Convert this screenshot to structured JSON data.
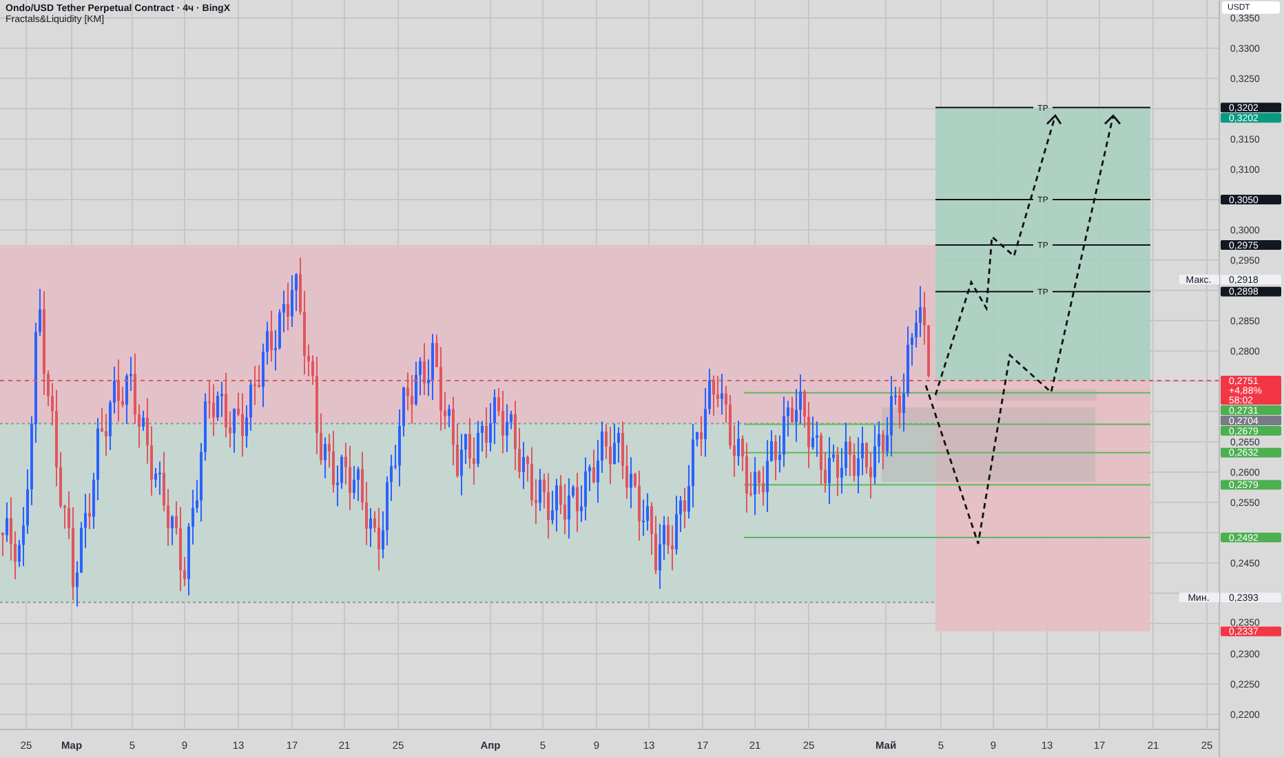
{
  "header": {
    "title": "Ondo/USD Tether Perpetual Contract · 4ч · BingX",
    "indicator": "Fractals&Liquidity [KM]"
  },
  "currency": "USDT",
  "price_axis": {
    "ticks": [
      "0,3350",
      "0,3300",
      "0,3250",
      "0,3150",
      "0,3100",
      "0,3000",
      "0,2950",
      "0,2850",
      "0,2800",
      "0,2650",
      "0,2600",
      "0,2550",
      "0,2450",
      "0,2350",
      "0,2300",
      "0,2250",
      "0,2200"
    ]
  },
  "price_labels": [
    {
      "value": "0,3202",
      "color": "#131722"
    },
    {
      "value": "0,3202",
      "color": "#089981"
    },
    {
      "value": "0,3050",
      "color": "#131722"
    },
    {
      "value": "0,2975",
      "color": "#131722"
    },
    {
      "caption": "Макс.",
      "value": "0,2918",
      "color": "#eef0f4"
    },
    {
      "value": "0,2898",
      "color": "#131722"
    },
    {
      "value": "0,2751",
      "color": "#f23645",
      "change": "+4,88%",
      "countdown": "58:02"
    },
    {
      "value": "0,2731",
      "color": "#4caf50"
    },
    {
      "value": "0,2704",
      "color": "#787b86"
    },
    {
      "value": "0,2679",
      "color": "#4caf50"
    },
    {
      "value": "0,2632",
      "color": "#4caf50"
    },
    {
      "value": "0,2579",
      "color": "#4caf50"
    },
    {
      "value": "0,2492",
      "color": "#4caf50"
    },
    {
      "caption": "Мин.",
      "value": "0,2393",
      "color": "#eef0f4"
    },
    {
      "value": "0,2337",
      "color": "#f23645"
    }
  ],
  "targets": [
    {
      "label": "TP"
    },
    {
      "label": "TP"
    },
    {
      "label": "TP"
    },
    {
      "label": "TP"
    }
  ],
  "time_axis": {
    "labels": [
      {
        "text": "25",
        "kind": "day"
      },
      {
        "text": "Мар",
        "kind": "month"
      },
      {
        "text": "5",
        "kind": "day"
      },
      {
        "text": "9",
        "kind": "day"
      },
      {
        "text": "13",
        "kind": "day"
      },
      {
        "text": "17",
        "kind": "day"
      },
      {
        "text": "21",
        "kind": "day"
      },
      {
        "text": "25",
        "kind": "day"
      },
      {
        "text": "Апр",
        "kind": "month"
      },
      {
        "text": "5",
        "kind": "day"
      },
      {
        "text": "9",
        "kind": "day"
      },
      {
        "text": "13",
        "kind": "day"
      },
      {
        "text": "17",
        "kind": "day"
      },
      {
        "text": "21",
        "kind": "day"
      },
      {
        "text": "25",
        "kind": "day"
      },
      {
        "text": "Май",
        "kind": "month"
      },
      {
        "text": "5",
        "kind": "day"
      },
      {
        "text": "9",
        "kind": "day"
      },
      {
        "text": "13",
        "kind": "day"
      },
      {
        "text": "17",
        "kind": "day"
      },
      {
        "text": "21",
        "kind": "day"
      },
      {
        "text": "25",
        "kind": "day"
      }
    ]
  }
}
